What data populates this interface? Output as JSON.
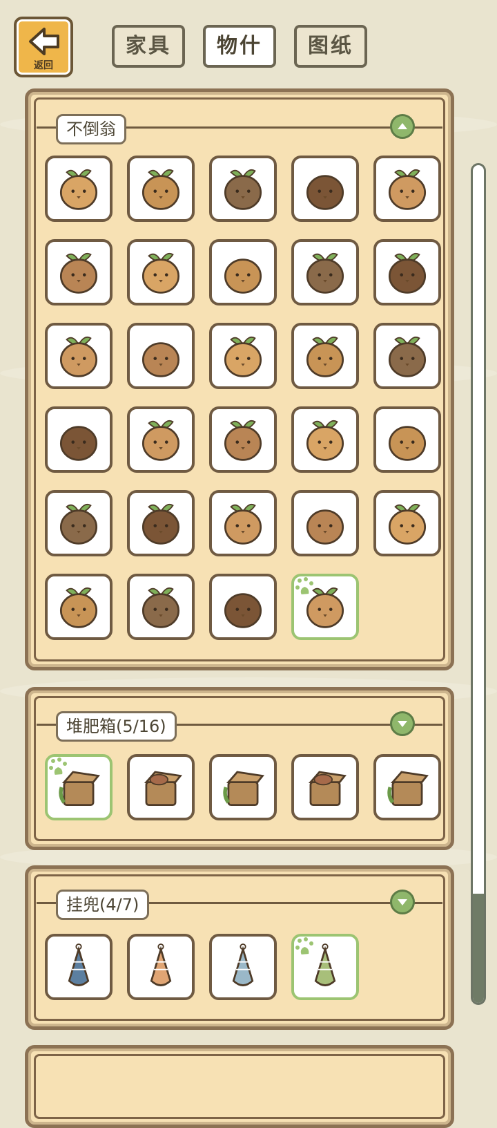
{
  "header": {
    "back_label": "返回",
    "tabs": [
      {
        "label": "家具",
        "active": false
      },
      {
        "label": "物什",
        "active": true
      },
      {
        "label": "图纸",
        "active": false
      }
    ]
  },
  "sections": [
    {
      "label": "不倒翁",
      "expanded": true,
      "item_count": 29,
      "selected_index": 28
    },
    {
      "label": "堆肥箱(5/16)",
      "expanded": false,
      "item_count": 5,
      "selected_index": 0
    },
    {
      "label": "挂兜(4/7)",
      "expanded": false,
      "item_count": 4,
      "selected_index": 3
    }
  ],
  "colors": {
    "background": "#e9e4cf",
    "panel": "#f7e1b4",
    "accent_green": "#8fb76b",
    "back_button": "#efb64a"
  }
}
